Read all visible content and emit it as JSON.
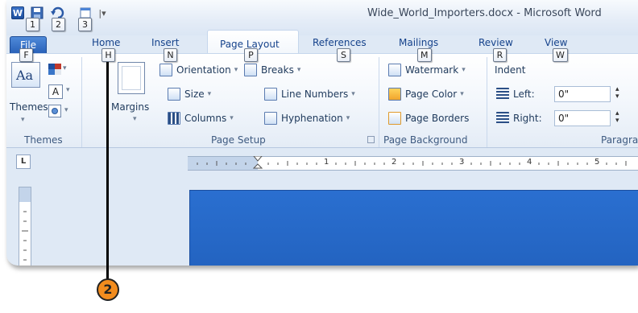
{
  "window": {
    "app_letter": "W",
    "title": "Wide_World_Importers.docx - Microsoft Word"
  },
  "qat": {
    "keytips": [
      "1",
      "2",
      "3"
    ],
    "customize_label": "|▾"
  },
  "tabs": [
    {
      "label": "File",
      "keytip": "F"
    },
    {
      "label": "Home",
      "keytip": "H"
    },
    {
      "label": "Insert",
      "keytip": "N"
    },
    {
      "label": "Page Layout",
      "keytip": "P"
    },
    {
      "label": "References",
      "keytip": "S"
    },
    {
      "label": "Mailings",
      "keytip": "M"
    },
    {
      "label": "Review",
      "keytip": "R"
    },
    {
      "label": "View",
      "keytip": "W"
    }
  ],
  "ribbon": {
    "themes_group": {
      "label": "Themes",
      "themes_button": "Themes"
    },
    "page_setup_group": {
      "label": "Page Setup",
      "margins": "Margins",
      "orientation": "Orientation",
      "size": "Size",
      "columns": "Columns",
      "breaks": "Breaks",
      "line_numbers": "Line Numbers",
      "hyphenation": "Hyphenation"
    },
    "page_background_group": {
      "label": "Page Background",
      "watermark": "Watermark",
      "page_color": "Page Color",
      "page_borders": "Page Borders"
    },
    "paragraph_group": {
      "label": "Paragra",
      "indent_header": "Indent",
      "left_label": "Left:",
      "left_value": "0\"",
      "right_label": "Right:",
      "right_value": "0\""
    }
  },
  "ruler": {
    "tab_selector": "L",
    "numbers": [
      "1",
      "2",
      "3",
      "4",
      "5"
    ]
  },
  "callout": {
    "number": "2"
  },
  "colors": {
    "accent": "#2a62b9",
    "ribbon_bg": "#e4ecf6",
    "callout": "#f28c1e",
    "page": "#2363c0"
  }
}
